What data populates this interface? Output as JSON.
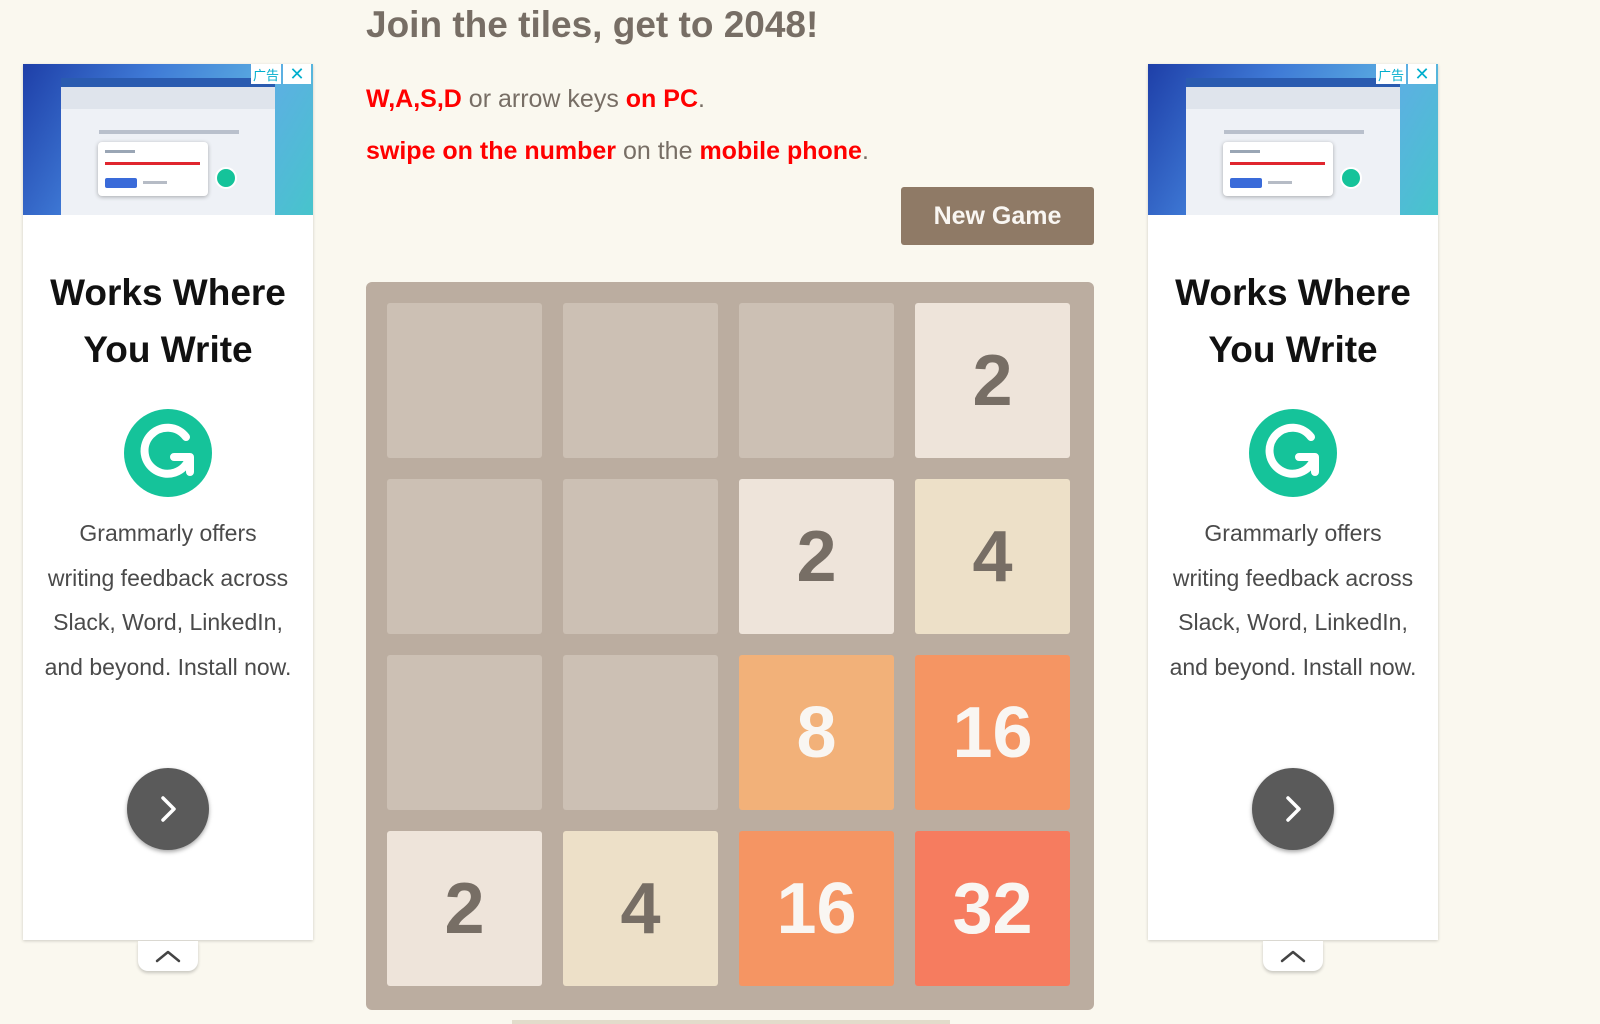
{
  "header": {
    "title": "Join the tiles, get to 2048!",
    "instructions": {
      "keys": "W,A,S,D",
      "keys_mid": " or arrow keys ",
      "keys_where": "on PC",
      "keys_end": ".",
      "swipe": "swipe on the number",
      "swipe_mid": " on the ",
      "swipe_where": "mobile phone",
      "swipe_end": "."
    },
    "new_game_label": "New Game"
  },
  "board": {
    "size": 4,
    "grid": [
      [
        null,
        null,
        null,
        2
      ],
      [
        null,
        null,
        2,
        4
      ],
      [
        null,
        null,
        8,
        16
      ],
      [
        2,
        4,
        16,
        32
      ]
    ],
    "tile_colors": {
      "empty": "#cdc1b4",
      "2": "#eee4da",
      "4": "#ede0c8",
      "8": "#f2b179",
      "16": "#f59563",
      "32": "#f67c5f"
    }
  },
  "ads": {
    "left": {
      "ad_tag": "广告",
      "title_line1": "Works Where",
      "title_line2": "You Write",
      "body": "Grammarly offers writing feedback across Slack, Word, LinkedIn, and beyond. Install now.",
      "logo_icon": "grammarly-g-icon",
      "cta_icon": "chevron-right-icon",
      "collapse_icon": "chevron-up-icon",
      "brand_color": "#15c39a"
    },
    "right": {
      "ad_tag": "广告",
      "title_line1": "Works Where",
      "title_line2": "You Write",
      "body": "Grammarly offers writing feedback across Slack, Word, LinkedIn, and beyond. Install now.",
      "logo_icon": "grammarly-g-icon",
      "cta_icon": "chevron-right-icon",
      "collapse_icon": "chevron-up-icon",
      "brand_color": "#15c39a"
    }
  }
}
